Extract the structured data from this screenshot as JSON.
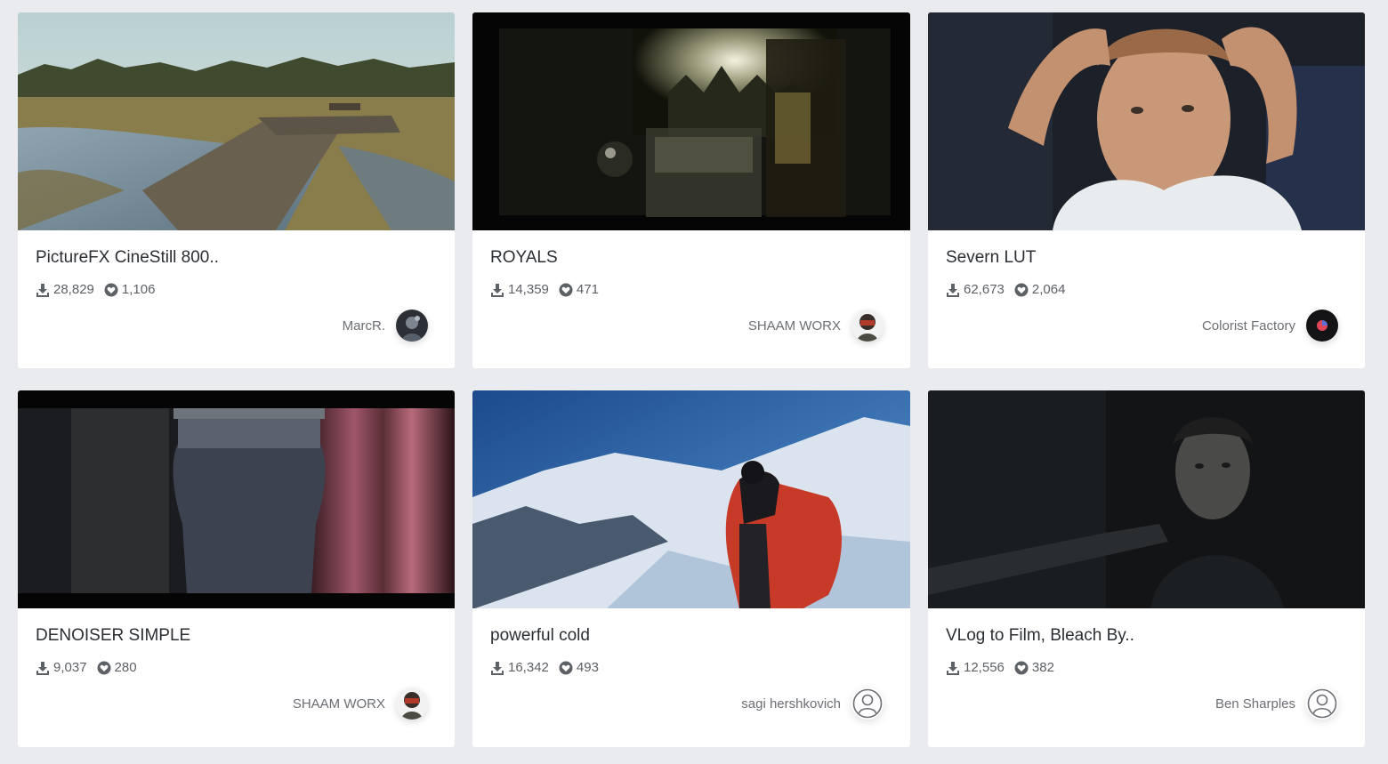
{
  "cards": [
    {
      "title": "PictureFX CineStill 800..",
      "downloads": "28,829",
      "likes": "1,106",
      "author": "MarcR.",
      "avatar": "photo"
    },
    {
      "title": "ROYALS",
      "downloads": "14,359",
      "likes": "471",
      "author": "SHAAM WORX",
      "avatar": "photo"
    },
    {
      "title": "Severn LUT",
      "downloads": "62,673",
      "likes": "2,064",
      "author": "Colorist Factory",
      "avatar": "logo"
    },
    {
      "title": "DENOISER SIMPLE",
      "downloads": "9,037",
      "likes": "280",
      "author": "SHAAM WORX",
      "avatar": "photo"
    },
    {
      "title": "powerful cold",
      "downloads": "16,342",
      "likes": "493",
      "author": "sagi hershkovich",
      "avatar": "placeholder-user-icon"
    },
    {
      "title": "VLog to Film, Bleach By..",
      "downloads": "12,556",
      "likes": "382",
      "author": "Ben Sharples",
      "avatar": "placeholder-user-icon"
    }
  ],
  "icons": {
    "downloads": "download-icon",
    "likes": "heart-icon"
  },
  "colors": {
    "background": "#e9ebee",
    "card": "#ffffff",
    "title": "#2b2f33",
    "meta": "#5d6166"
  }
}
